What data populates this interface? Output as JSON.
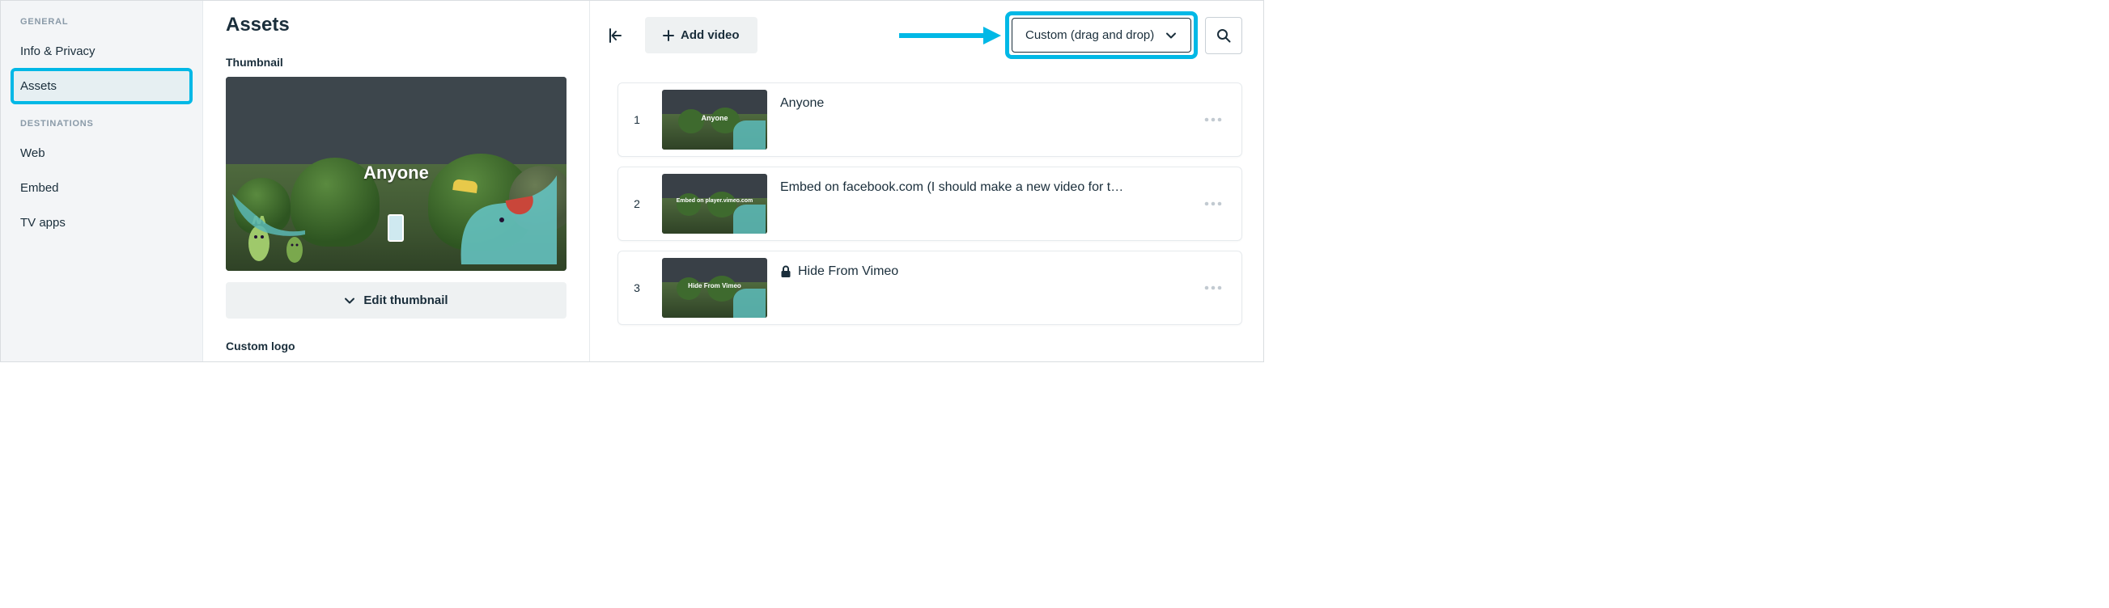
{
  "sidebar": {
    "section1_label": "GENERAL",
    "section2_label": "DESTINATIONS",
    "items": {
      "info_privacy": "Info & Privacy",
      "assets": "Assets",
      "web": "Web",
      "embed": "Embed",
      "tv_apps": "TV apps"
    }
  },
  "middle": {
    "title": "Assets",
    "thumbnail_section": "Thumbnail",
    "thumbnail_overlay": "Anyone",
    "edit_thumbnail": "Edit thumbnail",
    "custom_logo_section": "Custom logo"
  },
  "right": {
    "add_video": "Add video",
    "sort_label": "Custom (drag and drop)",
    "videos": [
      {
        "index": "1",
        "title": "Anyone",
        "thumb_label": "Anyone",
        "locked": false
      },
      {
        "index": "2",
        "title": "Embed on facebook.com (I should make a new video for t…",
        "thumb_label": "Embed on player.vimeo.com",
        "locked": false
      },
      {
        "index": "3",
        "title": "Hide From Vimeo",
        "thumb_label": "Hide From Vimeo",
        "locked": true
      }
    ]
  },
  "annotations": {
    "hex": "#00b8e6"
  }
}
